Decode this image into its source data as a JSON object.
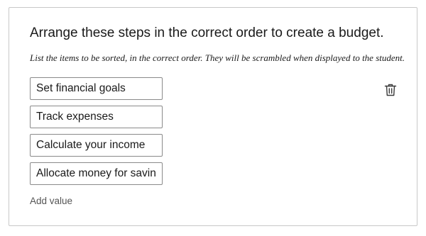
{
  "question": {
    "title": "Arrange these steps in the correct order to create a budget.",
    "hint": "List the items to be sorted, in the correct order. They will be scrambled when displayed to the student."
  },
  "values": [
    "Set financial goals",
    "Track expenses",
    "Calculate your income",
    "Allocate money for savings"
  ],
  "actions": {
    "add_value_label": "Add value",
    "delete_icon": "trash-icon"
  }
}
